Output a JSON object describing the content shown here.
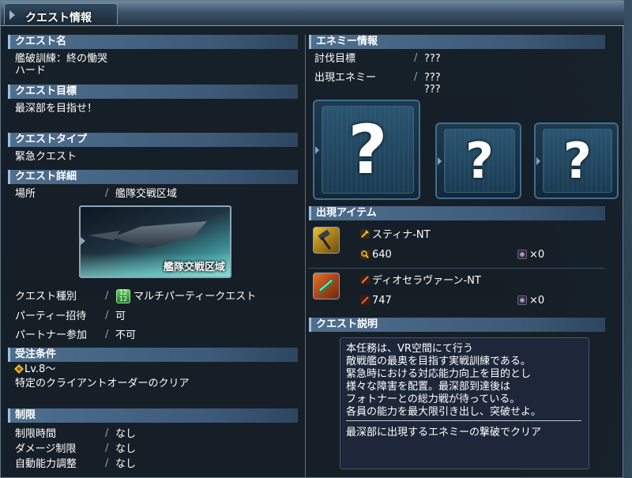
{
  "window": {
    "title": "クエスト情報"
  },
  "left": {
    "quest_name": {
      "header": "クエスト名",
      "name": "艦破訓練：終の慟哭",
      "difficulty": "ハード"
    },
    "quest_goal": {
      "header": "クエスト目標",
      "text": "最深部を目指せ！"
    },
    "quest_type": {
      "header": "クエストタイプ",
      "text": "緊急クエスト"
    },
    "quest_detail": {
      "header": "クエスト詳細",
      "location_label": "場所",
      "location_value": "艦隊交戦区域",
      "location_image_caption": "艦隊交戦区域",
      "category_label": "クエスト種別",
      "category_value": "マルチパーティークエスト",
      "party_invite_label": "パーティー招待",
      "party_invite_value": "可",
      "partner_label": "パートナー参加",
      "partner_value": "不可"
    },
    "requirements": {
      "header": "受注条件",
      "level": "Lv.8～",
      "text": "特定のクライアントオーダーのクリア"
    },
    "limits": {
      "header": "制限",
      "rows": [
        {
          "label": "制限時間",
          "value": "なし"
        },
        {
          "label": "ダメージ制限",
          "value": "なし"
        },
        {
          "label": "自動能力調整",
          "value": "なし"
        }
      ]
    }
  },
  "right": {
    "enemy_info": {
      "header": "エネミー情報",
      "target_label": "討伐目標",
      "target_value": "???",
      "appear_label": "出現エネミー",
      "appear_values": [
        "???",
        "???"
      ],
      "unknown_glyph": "?"
    },
    "items": {
      "header": "出現アイテム",
      "list": [
        {
          "name": "スティナ-NT",
          "power": "640",
          "count": "×0"
        },
        {
          "name": "ディオセラヴァーン-NT",
          "power": "747",
          "count": "×0"
        }
      ]
    },
    "description": {
      "header": "クエスト説明",
      "lines": [
        "本任務は、VR空間にて行う",
        "敵戦艦の最奥を目指す実戦訓練である。",
        "緊急時における対応能力向上を目的とし",
        "様々な障害を配置。最深部到達後は",
        "フォトナーとの総力戦が待っている。",
        "各員の能力を最大限引き出し、突破せよ。"
      ],
      "clear_condition": "最深部に出現するエネミーの撃破でクリア"
    }
  },
  "colors": {
    "header_bg": "#4f6f8e",
    "window_bg": "#161e26",
    "accent": "#9cc1df"
  }
}
